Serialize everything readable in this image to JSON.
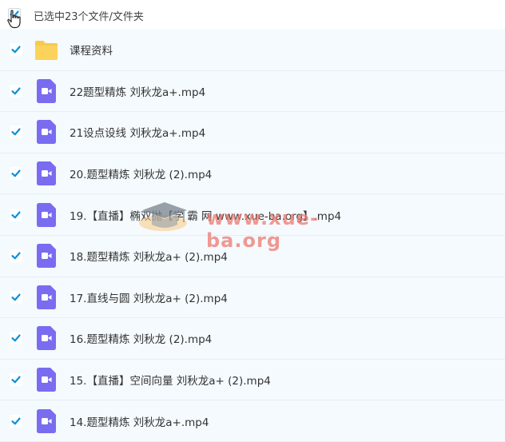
{
  "header": {
    "selection_text": "已选中23个文件/文件夹",
    "select_all_checked": true
  },
  "items": [
    {
      "type": "folder",
      "name": "课程资料",
      "checked": true
    },
    {
      "type": "video",
      "name": "22题型精炼 刘秋龙a+.mp4",
      "checked": true
    },
    {
      "type": "video",
      "name": "21设点设线 刘秋龙a+.mp4",
      "checked": true
    },
    {
      "type": "video",
      "name": "20.题型精炼 刘秋龙 (2).mp4",
      "checked": true
    },
    {
      "type": "video",
      "name": "19.【直播】椭双抛【学 霸 网 www.xue-ba.org】.mp4",
      "checked": true
    },
    {
      "type": "video",
      "name": "18.题型精炼 刘秋龙a+ (2).mp4",
      "checked": true
    },
    {
      "type": "video",
      "name": "17.直线与圆 刘秋龙a+ (2).mp4",
      "checked": true
    },
    {
      "type": "video",
      "name": "16.题型精炼 刘秋龙 (2).mp4",
      "checked": true
    },
    {
      "type": "video",
      "name": "15.【直播】空间向量 刘秋龙a+ (2).mp4",
      "checked": true
    },
    {
      "type": "video",
      "name": "14.题型精炼 刘秋龙a+.mp4",
      "checked": true
    }
  ],
  "watermark": {
    "text": "www.xue-ba.org"
  },
  "colors": {
    "checkbox": "#0a8fdc",
    "folder": "#f8c94c",
    "video": "#7a6cf0",
    "row_bg": "#f4fafe"
  }
}
